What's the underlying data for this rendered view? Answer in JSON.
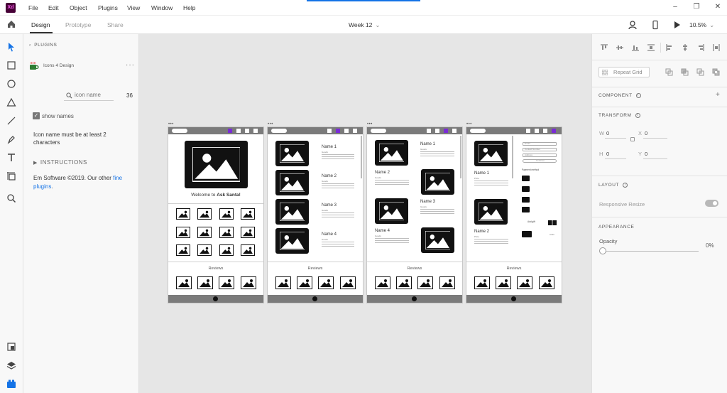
{
  "app": {
    "logo": "Xd"
  },
  "menu": [
    "File",
    "Edit",
    "Object",
    "Plugins",
    "View",
    "Window",
    "Help"
  ],
  "tabs": {
    "design": "Design",
    "prototype": "Prototype",
    "share": "Share"
  },
  "document": {
    "title": "Week 12"
  },
  "zoom": "10.5%",
  "plugins_panel": {
    "header": "PLUGINS",
    "plugin_name": "Icons 4 Design",
    "search_placeholder": "icon name",
    "size_value": "36",
    "show_names_label": "show names",
    "warning": "Icon name must be at least 2 characters",
    "instructions": "INSTRUCTIONS",
    "credit_text": "Em Software ©2019. Our other ",
    "credit_link_1": "fine",
    "credit_link_2": "plugins",
    "credit_end": "."
  },
  "artboards": {
    "welcome_prefix": "Welcome to ",
    "welcome_bold": "Ask Santa!",
    "reviews": "Reviews",
    "names": [
      "Name 1",
      "Name 2",
      "Name 3",
      "Name 4"
    ],
    "goods": "Goods",
    "price": "Price",
    "form_fields": [
      "Email",
      "Contact Number",
      "Address",
      "Continue"
    ],
    "payment_method": "Payment method",
    "add_gift": "Add gift",
    "cod": "COD"
  },
  "right_panel": {
    "repeat_grid": "Repeat Grid",
    "component": "COMPONENT",
    "transform": "TRANSFORM",
    "w_label": "W",
    "w_value": "0",
    "h_label": "H",
    "h_value": "0",
    "x_label": "X",
    "x_value": "0",
    "y_label": "Y",
    "y_value": "0",
    "layout": "LAYOUT",
    "responsive_resize": "Responsive Resize",
    "appearance": "APPEARANCE",
    "opacity_label": "Opacity",
    "opacity_value": "0%"
  },
  "colors": {
    "accent": "#1473e6",
    "xd_brand": "#470137",
    "purple": "#7a2bd6"
  }
}
